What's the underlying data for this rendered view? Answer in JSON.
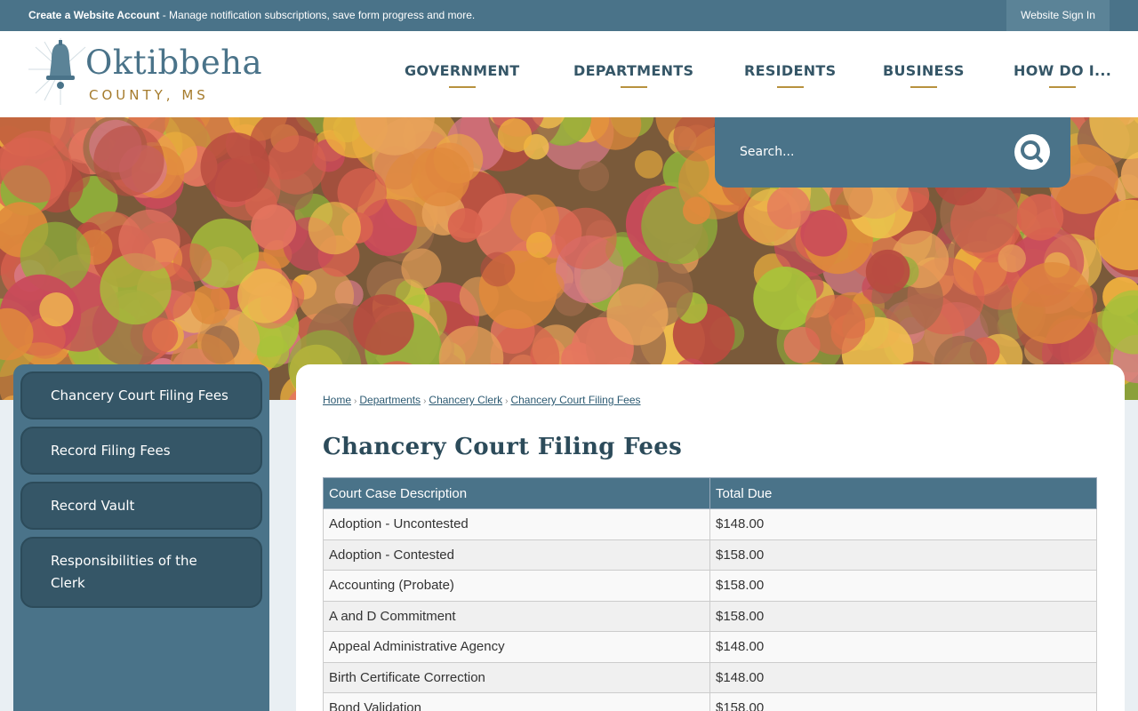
{
  "topbar": {
    "account_link": "Create a Website Account",
    "account_msg": " - Manage notification subscriptions, save form progress and more.",
    "signin_label": "Website Sign In"
  },
  "logo": {
    "title": "Oktibbeha",
    "subtitle": "COUNTY, MS"
  },
  "nav": {
    "items": [
      {
        "label": "GOVERNMENT"
      },
      {
        "label": "DEPARTMENTS"
      },
      {
        "label": "RESIDENTS"
      },
      {
        "label": "BUSINESS"
      },
      {
        "label": "HOW DO I..."
      }
    ]
  },
  "search": {
    "placeholder": "Search..."
  },
  "sidebar": {
    "items": [
      {
        "label": "Chancery Court Filing Fees"
      },
      {
        "label": "Record Filing Fees"
      },
      {
        "label": "Record Vault"
      },
      {
        "label": "Responsibilities of the Clerk"
      }
    ]
  },
  "breadcrumb": [
    "Home",
    "Departments",
    "Chancery Clerk",
    "Chancery Court Filing Fees"
  ],
  "page": {
    "title": "Chancery Court Filing Fees"
  },
  "fees_table": {
    "headers": [
      "Court Case Description",
      "Total Due"
    ],
    "rows": [
      [
        "Adoption - Uncontested",
        "$148.00"
      ],
      [
        "Adoption - Contested",
        "$158.00"
      ],
      [
        "Accounting (Probate)",
        "$158.00"
      ],
      [
        "A and D Commitment",
        "$158.00"
      ],
      [
        "Appeal Administrative Agency",
        "$148.00"
      ],
      [
        "Birth Certificate Correction",
        "$148.00"
      ],
      [
        "Bond Validation",
        "$158.00"
      ]
    ]
  },
  "colors": {
    "brand_blue": "#4a7389",
    "dark_blue": "#355667",
    "gold": "#b8923e"
  }
}
